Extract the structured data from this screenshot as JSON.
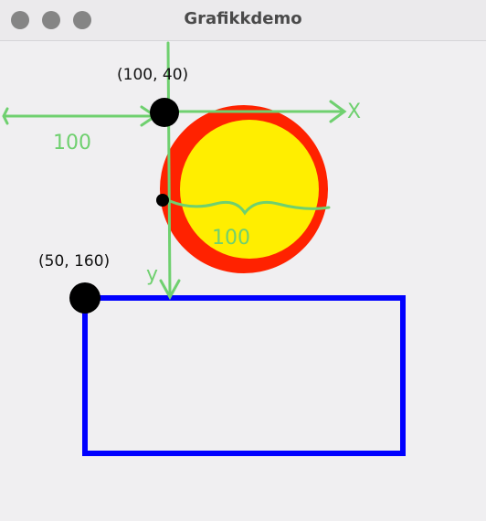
{
  "window": {
    "title": "Grafikkdemo",
    "controls": [
      "close-button",
      "minimize-button",
      "zoom-button"
    ]
  },
  "drawing": {
    "colors": {
      "circle_outer": "#ff2200",
      "circle_inner": "#ffee00",
      "rectangle": "#0000ff",
      "annotation": "#6fd06f",
      "point": "#000000"
    },
    "labels": {
      "circle_origin": "(100, 40)",
      "rect_origin": "(50, 160)",
      "x_axis": "X",
      "y_axis": "y",
      "left_distance": "100",
      "circle_width": "100"
    }
  }
}
